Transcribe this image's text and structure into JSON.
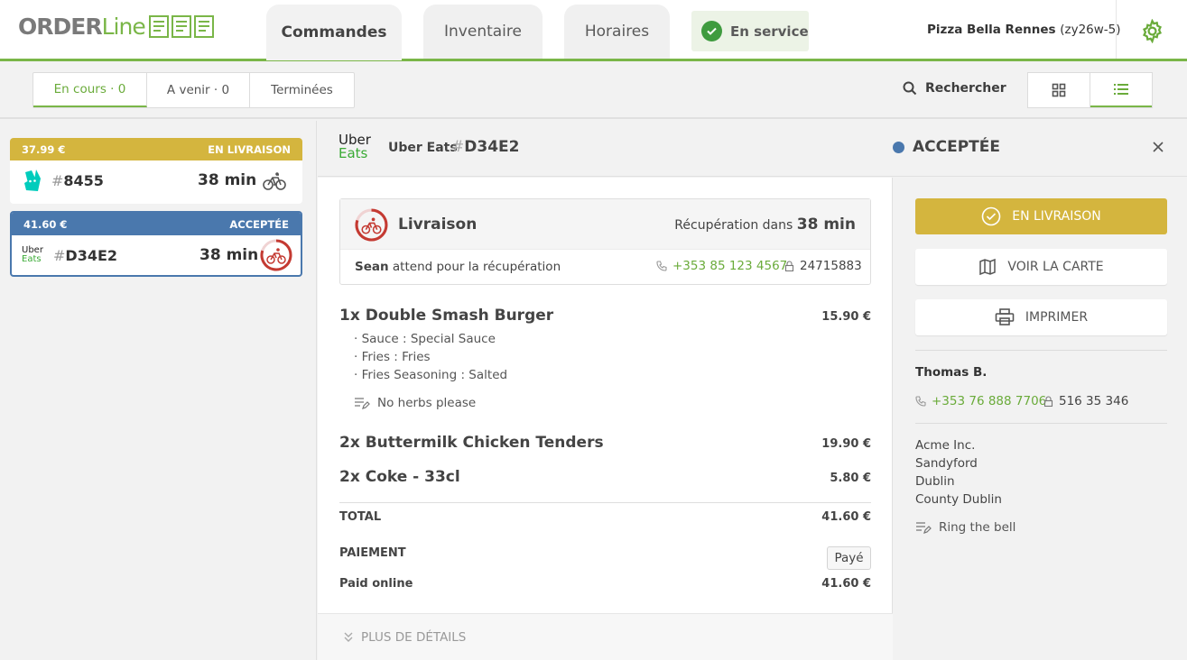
{
  "header": {
    "logo_part1": "ORDER",
    "logo_part2": "Line",
    "tabs": [
      {
        "label": "Commandes"
      },
      {
        "label": "Inventaire"
      },
      {
        "label": "Horaires"
      }
    ],
    "service_label": "En service",
    "store_name": "Pizza Bella Rennes",
    "store_code": "(zy26w-5)",
    "accent": "#7ab648"
  },
  "toolbar": {
    "filters": [
      {
        "label": "En cours",
        "count": "0"
      },
      {
        "label": "A venir",
        "count": "0"
      },
      {
        "label": "Terminées",
        "count": ""
      }
    ],
    "search_label": "Rechercher"
  },
  "orders": [
    {
      "amount": "37.99 €",
      "status": "EN LIVRAISON",
      "number": "8455",
      "time": "38 min",
      "bar_color": "#d4b53e"
    },
    {
      "amount": "41.60 €",
      "status": "ACCEPTÉE",
      "number": "D34E2",
      "time": "38 min",
      "bar_color": "#4a78ad",
      "logo_top": "Uber",
      "logo_bottom": "Eats"
    }
  ],
  "detail": {
    "logo_top": "Uber",
    "logo_bottom": "Eats",
    "platform": "Uber Eats",
    "order_number": "D34E2",
    "status": "ACCEPTÉE",
    "status_color": "#4a78ad",
    "delivery": {
      "title": "Livraison",
      "pickup_prefix": "Récupération dans",
      "pickup_time": "38 min",
      "courier": "Sean",
      "courier_text": "attend pour la récupération",
      "phone": "+353 85 123 4567",
      "code": "24715883"
    },
    "items": [
      {
        "name": "1x Double Smash Burger",
        "price": "15.90 €"
      },
      {
        "name": "2x Buttermilk Chicken Tenders",
        "price": "19.90 €"
      },
      {
        "name": "2x Coke - 33cl",
        "price": "5.80 €"
      }
    ],
    "modifiers": [
      "Sauce : Special Sauce",
      "Fries : Fries",
      "Fries Seasoning : Salted"
    ],
    "item_note": "No herbs please",
    "total_label": "TOTAL",
    "total_value": "41.60 €",
    "payment_label": "PAIEMENT",
    "payment_badge": "Payé",
    "paid_label": "Paid online",
    "paid_value": "41.60 €",
    "more_label": "PLUS DE DÉTAILS"
  },
  "actions": {
    "primary": "EN LIVRAISON",
    "map": "VOIR LA CARTE",
    "print": "IMPRIMER"
  },
  "customer": {
    "name": "Thomas B.",
    "phone": "+353 76 888 7706",
    "code": "516 35 346",
    "address": [
      "Acme Inc.",
      "Sandyford",
      "Dublin",
      "County Dublin"
    ],
    "note": "Ring the bell"
  }
}
